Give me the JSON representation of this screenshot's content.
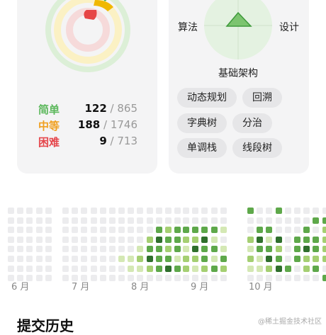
{
  "difficulty": [
    {
      "label": "简单",
      "solved": "122",
      "total": "/ 865",
      "color": "#5cb85c"
    },
    {
      "label": "中等",
      "solved": "188",
      "total": "/ 1746",
      "color": "#f0a020"
    },
    {
      "label": "困难",
      "solved": "9",
      "total": "/ 713",
      "color": "#e5484d"
    }
  ],
  "radar": {
    "left": "算法",
    "right": "设计",
    "bottom": "基础架构"
  },
  "tags": [
    "动态规划",
    "回溯",
    "字典树",
    "分治",
    "单调栈",
    "线段树"
  ],
  "months": [
    "6 月",
    "7 月",
    "8 月",
    "9 月",
    "10 月"
  ],
  "history_title": "提交历史",
  "watermark": "@稀土掘金技术社区",
  "colors": {
    "level0": "#ececee",
    "level1": "#d4e8b4",
    "level2": "#a5cf72",
    "level3": "#5ea84a",
    "level4": "#2f6f2c"
  }
}
